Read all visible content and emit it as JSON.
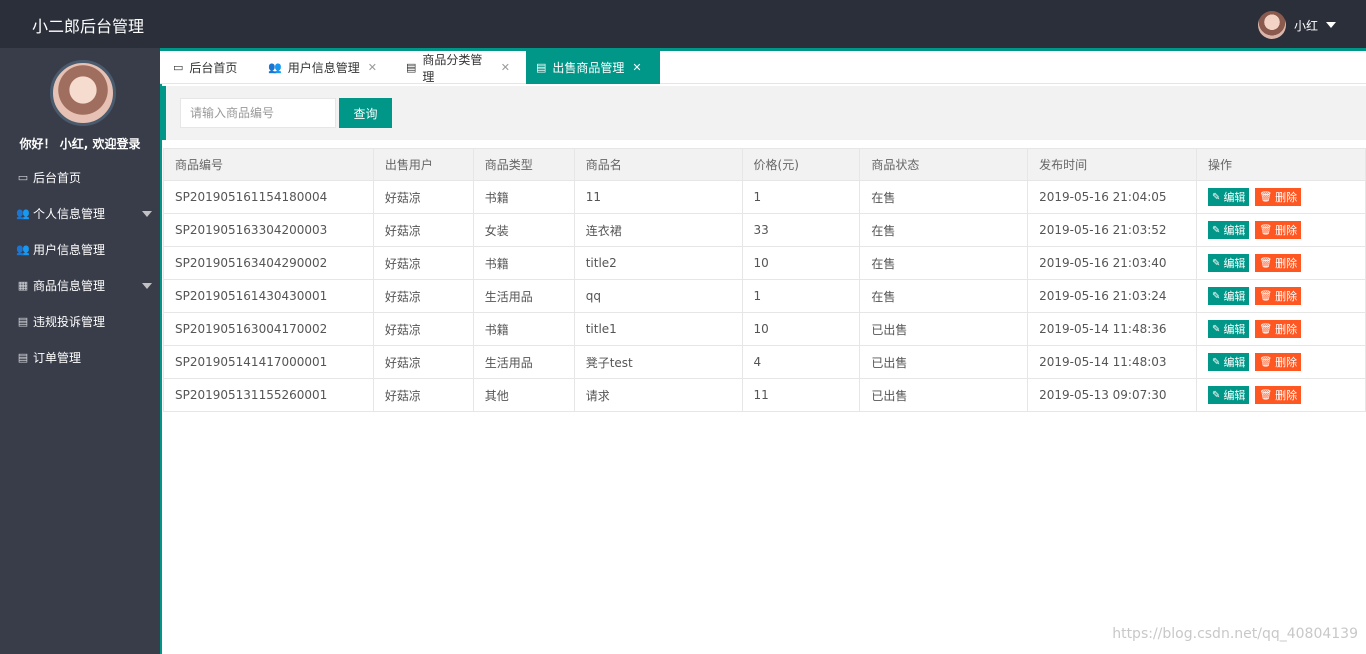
{
  "header": {
    "title": "小二郎后台管理",
    "username": "小红"
  },
  "sidebar": {
    "welcome": "你好！ 小红, 欢迎登录",
    "items": [
      {
        "label": "后台首页",
        "icon": "monitor-icon",
        "glyph": "▭",
        "dropdown": false
      },
      {
        "label": "个人信息管理",
        "icon": "users-icon",
        "glyph": "👥",
        "dropdown": true
      },
      {
        "label": "用户信息管理",
        "icon": "users-icon",
        "glyph": "👥",
        "dropdown": false
      },
      {
        "label": "商品信息管理",
        "icon": "cubes-icon",
        "glyph": "▦",
        "dropdown": true
      },
      {
        "label": "违规投诉管理",
        "icon": "files-icon",
        "glyph": "▤",
        "dropdown": false
      },
      {
        "label": "订单管理",
        "icon": "files-icon",
        "glyph": "▤",
        "dropdown": false
      }
    ]
  },
  "tabs": [
    {
      "label": "后台首页",
      "icon": "monitor-icon",
      "closable": false,
      "active": false
    },
    {
      "label": "用户信息管理",
      "icon": "users-icon",
      "closable": true,
      "active": false
    },
    {
      "label": "商品分类管理",
      "icon": "file-icon",
      "closable": true,
      "active": false
    },
    {
      "label": "出售商品管理",
      "icon": "file-icon",
      "closable": true,
      "active": true
    }
  ],
  "search": {
    "placeholder": "请输入商品编号",
    "button_label": "查询"
  },
  "table": {
    "columns": [
      "商品编号",
      "出售用户",
      "商品类型",
      "商品名",
      "价格(元)",
      "商品状态",
      "发布时间",
      "操作"
    ],
    "rows": [
      [
        "SP201905161154180004",
        "好菇凉",
        "书籍",
        "11",
        "1",
        "在售",
        "2019-05-16 21:04:05"
      ],
      [
        "SP201905163304200003",
        "好菇凉",
        "女装",
        "连衣裙",
        "33",
        "在售",
        "2019-05-16 21:03:52"
      ],
      [
        "SP201905163404290002",
        "好菇凉",
        "书籍",
        "title2",
        "10",
        "在售",
        "2019-05-16 21:03:40"
      ],
      [
        "SP201905161430430001",
        "好菇凉",
        "生活用品",
        "qq",
        "1",
        "在售",
        "2019-05-16 21:03:24"
      ],
      [
        "SP201905163004170002",
        "好菇凉",
        "书籍",
        "title1",
        "10",
        "已出售",
        "2019-05-14 11:48:36"
      ],
      [
        "SP201905141417000001",
        "好菇凉",
        "生活用品",
        "凳子test",
        "4",
        "已出售",
        "2019-05-14 11:48:03"
      ],
      [
        "SP201905131155260001",
        "好菇凉",
        "其他",
        "请求",
        "11",
        "已出售",
        "2019-05-13 09:07:30"
      ]
    ],
    "edit_label": "编辑",
    "delete_label": "删除"
  },
  "watermark": "https://blog.csdn.net/qq_40804139",
  "colors": {
    "accent": "#009688",
    "danger": "#ff5722",
    "topbar": "#2b2f3a",
    "sidebar": "#393d49"
  }
}
